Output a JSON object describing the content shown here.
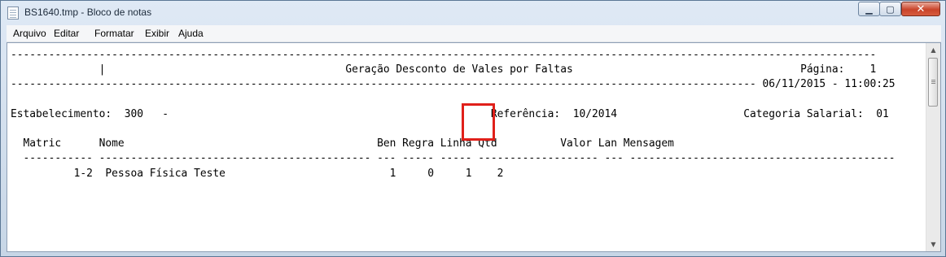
{
  "window": {
    "title": "BS1640.tmp - Bloco de notas",
    "icon": "notepad-icon"
  },
  "controls": {
    "minimize": "▁",
    "maximize": "▢",
    "close": "✕"
  },
  "menu": [
    "Arquivo",
    "Editar",
    "Formatar",
    "Exibir",
    "Ajuda"
  ],
  "report_lines": [
    "-----------------------------------------------------------------------------------------------------------------------------------------",
    "              |                                      Geração Desconto de Vales por Faltas                                    Página:    1",
    "---------------------------------------------------------------------------------------------------------------------- 06/11/2015 - 11:00:25",
    "",
    "Estabelecimento:  300   -                                                   Referência:  10/2014                    Categoria Salarial:  01",
    "",
    "  Matric      Nome                                        Ben Regra Linha Qtd          Valor Lan Mensagem",
    "  ----------- ------------------------------------------- --- ----- ----- ------------------- --- ------------------------------------------",
    "          1-2  Pessoa Física Teste                          1     0     1    2"
  ],
  "highlight": {
    "label": "Qtd",
    "value": "2",
    "color": "#e0201a"
  }
}
